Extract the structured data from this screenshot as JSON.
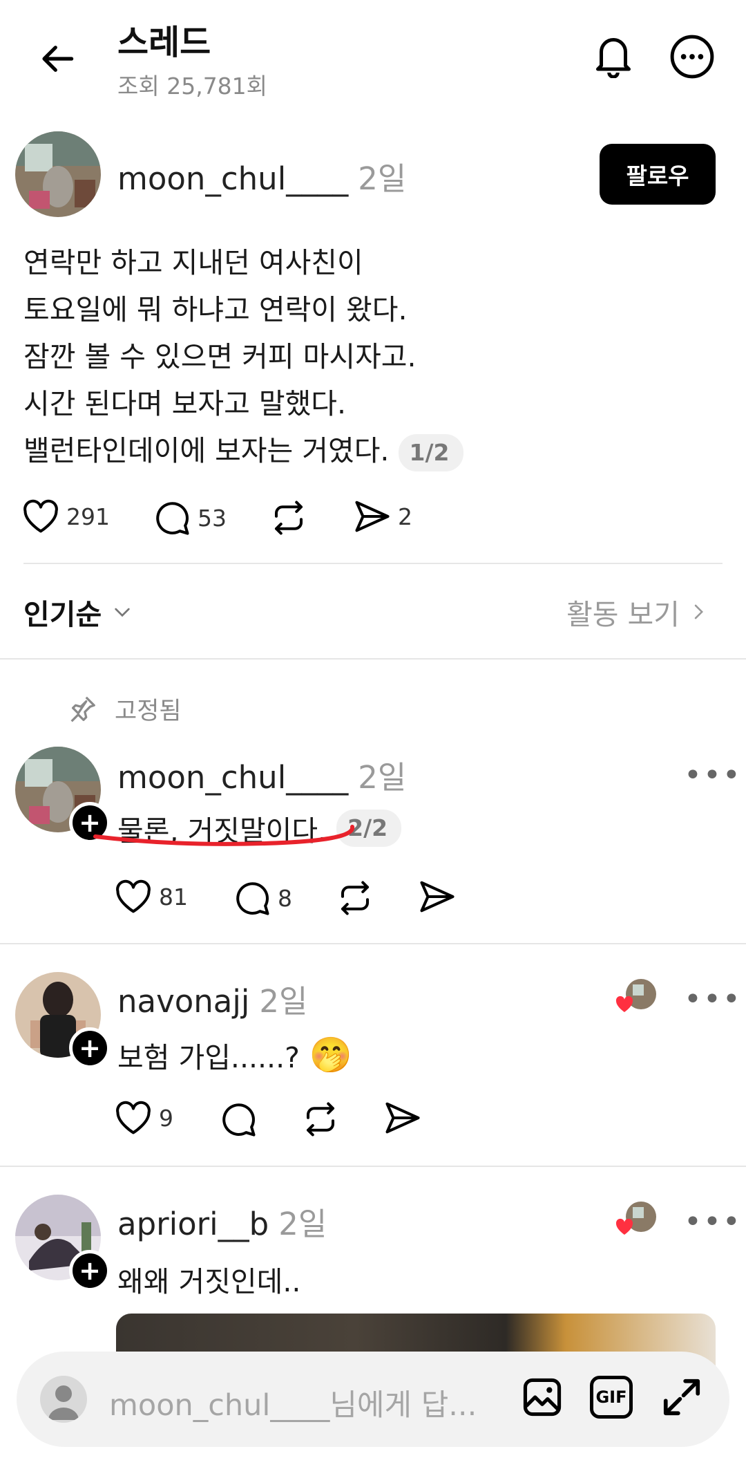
{
  "header": {
    "title": "스레드",
    "views": "조회 25,781회",
    "back_icon": "arrow-left-icon",
    "bell_icon": "bell-icon",
    "more_icon": "more-circle-icon"
  },
  "post": {
    "username": "moon_chul____",
    "time": "2일",
    "follow_label": "팔로우",
    "lines": [
      "연락만 하고 지내던 여사친이",
      "토요일에 뭐 하냐고 연락이 왔다.",
      "잠깐 볼 수 있으면 커피 마시자고.",
      "시간 된다며 보자고 말했다.",
      "밸런타인데이에 보자는 거였다."
    ],
    "page_indicator": "1/2",
    "likes": "291",
    "comments": "53",
    "shares": "2"
  },
  "sort": {
    "label": "인기순",
    "activity_label": "활동 보기"
  },
  "replies": [
    {
      "pinned_label": "고정됨",
      "username": "moon_chul____",
      "time": "2일",
      "text": "물론, 거짓말이다.",
      "page_indicator": "2/2",
      "likes": "81",
      "comments": "8",
      "highlight_color": "#e8222b"
    },
    {
      "username": "navonajj",
      "time": "2일",
      "text": "보험 가입......?",
      "emoji": "🤭",
      "likes": "9"
    },
    {
      "username": "apriori__b",
      "time": "2일",
      "text": "왜왜 거짓인데.."
    }
  ],
  "reply_bar": {
    "placeholder": "moon_chul____님에게 답...",
    "gif_label": "GIF"
  },
  "colors": {
    "heart_red": "#ff3040",
    "follow_bg": "#000000"
  }
}
